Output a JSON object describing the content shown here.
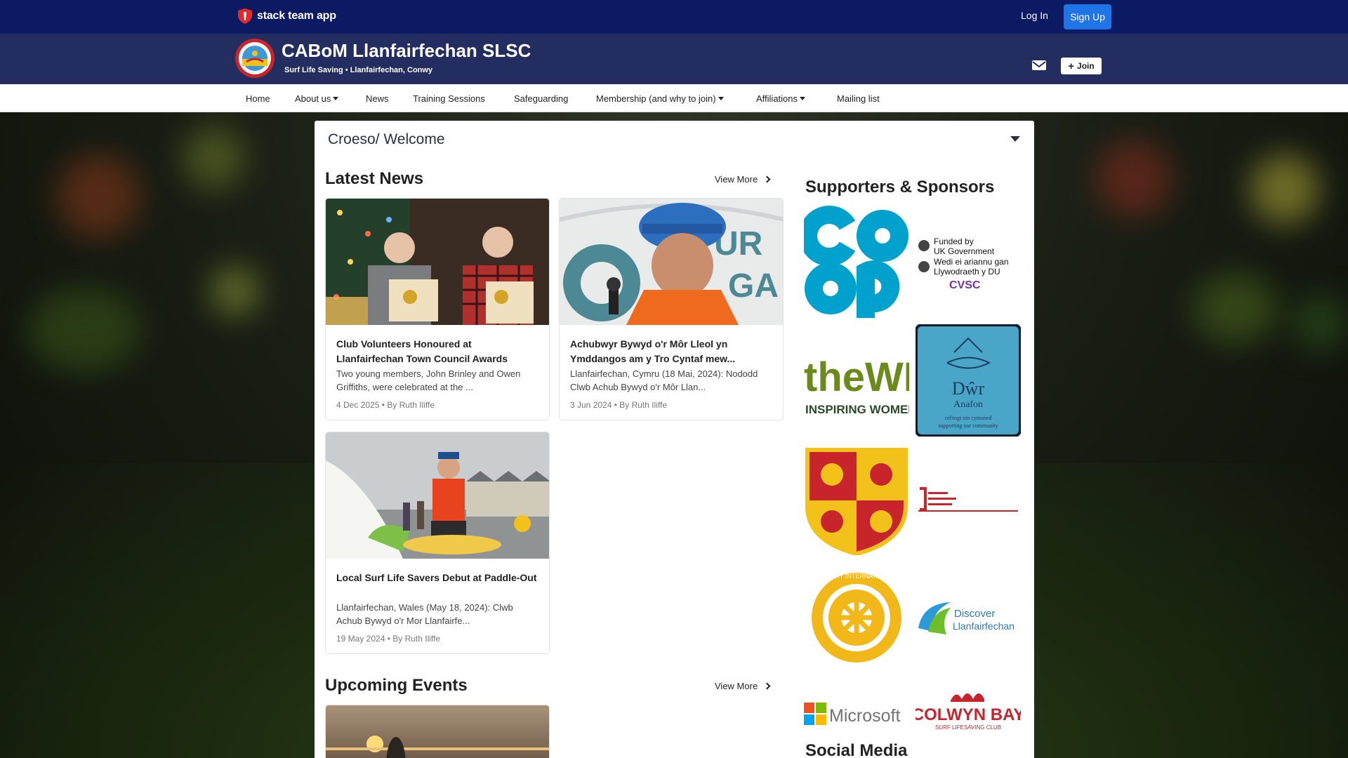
{
  "topbar": {
    "brand": "stack team app",
    "login": "Log In",
    "signup": "Sign Up"
  },
  "club": {
    "name": "CABoM Llanfairfechan SLSC",
    "subtitle": "Surf Life Saving • Llanfairfechan, Conwy",
    "join": "Join"
  },
  "nav": {
    "items": [
      {
        "label": "Home"
      },
      {
        "label": "About us"
      },
      {
        "label": "News"
      },
      {
        "label": "Training Sessions"
      },
      {
        "label": "Safeguarding"
      },
      {
        "label": "Membership (and why to join)"
      },
      {
        "label": "Affiliations"
      },
      {
        "label": "Mailing list"
      }
    ]
  },
  "welcome": {
    "title": "Croeso/ Welcome"
  },
  "news": {
    "title": "Latest News",
    "view_more": "View More",
    "items": [
      {
        "title": "Club Volunteers Honoured at Llanfairfechan Town Council Awards",
        "excerpt": "Two young members, John Brinley and Owen Griffiths, were celebrated at the ...",
        "meta": "4 Dec 2025 • By Ruth Iliffe"
      },
      {
        "title": "Achubwyr Bywyd o'r Môr Lleol yn Ymddangos am y Tro Cyntaf mew...",
        "excerpt": "Llanfairfechan, Cymru (18 Mai, 2024): Nododd Clwb Achub Bywyd o'r Môr Llan...",
        "meta": "3 Jun 2024 • By Ruth Iliffe"
      },
      {
        "title": "Local Surf Life Savers Debut at Paddle-Out",
        "excerpt": "Llanfairfechan, Wales (May 18, 2024): Clwb Achub Bywyd o'r Mor Llanfairfe...",
        "meta": "19 May 2024 • By Ruth Iliffe"
      }
    ]
  },
  "events": {
    "title": "Upcoming Events",
    "view_more": "View More"
  },
  "sponsors": {
    "title": "Supporters & Sponsors",
    "logos": {
      "coop": "co op",
      "ukgov_line1": "Funded by",
      "ukgov_line2": "UK Government",
      "ukgov_line3": "Wedi ei ariannu gan",
      "ukgov_line4": "Llywodraeth y DU",
      "cvsc": "CVSC",
      "wi_line1": "theWI",
      "wi_line2": "INSPIRING WOMEN",
      "dwr_line1": "Dŵr",
      "dwr_line2": "Anafon",
      "dwr_line3": "cefnogi ein cymuned",
      "dwr_line4": "supporting our community",
      "rotary": "ROTARY INTERNATIONAL",
      "discover_line1": "Discover",
      "discover_line2": "Llanfairfechan",
      "microsoft": "Microsoft",
      "colwyn_line1": "COLWYN BAY",
      "colwyn_line2": "SURF LIFESAVING CLUB"
    }
  },
  "social": {
    "title": "Social Media"
  },
  "colors": {
    "topbar": "#0b1a63",
    "clubhead": "#242d60",
    "signup": "#1f74e8",
    "coop": "#00a1cc"
  }
}
